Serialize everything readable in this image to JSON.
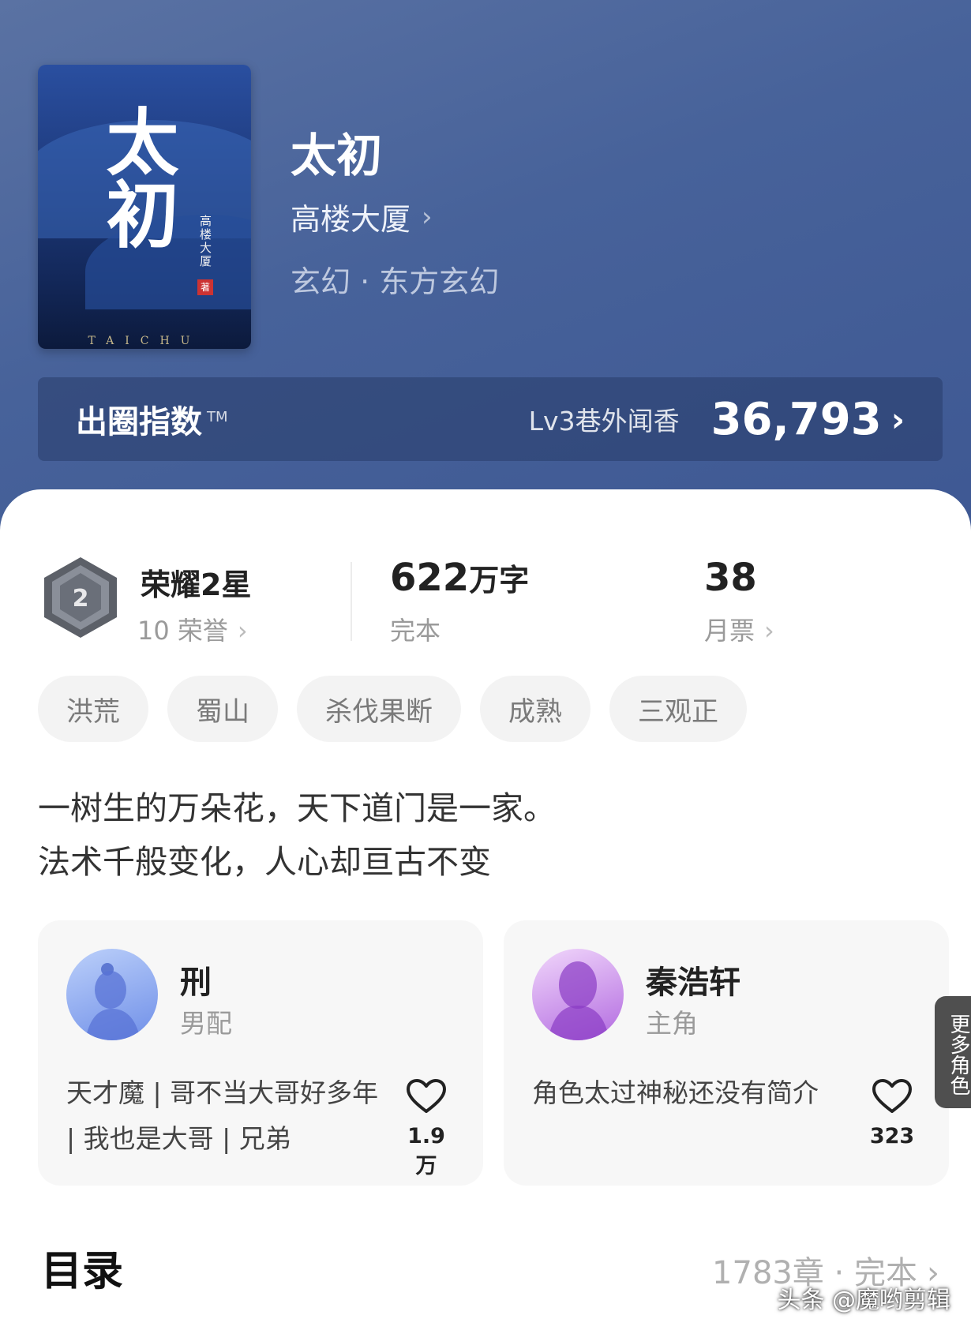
{
  "book": {
    "title": "太初",
    "author": "高楼大厦",
    "genre": "玄幻 · 东方玄幻",
    "cover": {
      "title_text": "太初",
      "author_text": "高楼大厦",
      "seal_text": "著",
      "pinyin_text": "TAICHU"
    }
  },
  "index_bar": {
    "label": "出圈指数",
    "tm": "TM",
    "level": "Lv3巷外闻香",
    "value": "36,793"
  },
  "stats": {
    "honor": {
      "title": "荣耀2星",
      "sub": "10 荣誉",
      "badge_number": "2"
    },
    "words": {
      "number": "622",
      "unit": "万字",
      "sub": "完本"
    },
    "votes": {
      "number": "38",
      "sub": "月票"
    }
  },
  "tags": [
    "洪荒",
    "蜀山",
    "杀伐果断",
    "成熟",
    "三观正"
  ],
  "blurb": {
    "line1": "一树生的万朵花，天下道门是一家。",
    "line2": "法术千般变化，人心却亘古不变"
  },
  "roles": [
    {
      "name": "刑",
      "type": "男配",
      "desc": "天才魔 | 哥不当大哥好多年 | 我也是大哥 | 兄弟",
      "likes": "1.9万"
    },
    {
      "name": "秦浩轩",
      "type": "主角",
      "desc": "角色太过神秘还没有简介",
      "likes": "323"
    }
  ],
  "more_roles_label": "更多角色",
  "toc": {
    "title": "目录",
    "meta": "1783章 · 完本"
  },
  "watermark": "头条 @魔哟剪辑",
  "colors": {
    "hero_bg": "#47629a",
    "accent_white": "#ffffff",
    "muted_text": "#9a9a9a"
  }
}
